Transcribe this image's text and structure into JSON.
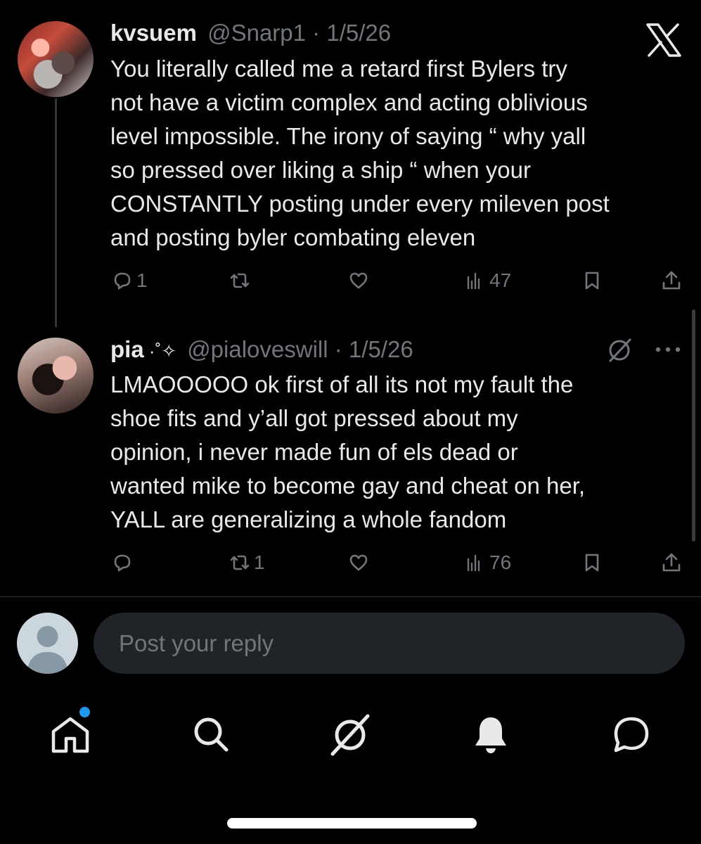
{
  "tweets": [
    {
      "display_name": "kvsuem",
      "handle": "@Snarp1",
      "separator": " · ",
      "date": "1/5/26",
      "lines": [
        "You literally called me a retard first Bylers try",
        "not have a victim complex and acting oblivious",
        "level impossible. The irony of saying “ why yall",
        "so pressed over liking a ship “ when your",
        "CONSTANTLY posting under every mileven post",
        "and posting byler combating eleven"
      ],
      "reply_count": "1",
      "repost_count": "",
      "view_count": "47"
    },
    {
      "display_name": "pia",
      "name_decoration": " ·˚✧",
      "handle": "@pialoveswill",
      "separator": " · ",
      "date": "1/5/26",
      "lines": [
        "LMAOOOOO ok first of all its not my fault the",
        "shoe fits and y’all got pressed about my",
        "opinion, i never made fun of els dead or",
        "wanted mike to become gay and cheat on her,",
        "YALL are generalizing a whole fandom"
      ],
      "reply_count": "",
      "repost_count": "1",
      "view_count": "76"
    }
  ],
  "reply": {
    "placeholder": "Post your reply"
  },
  "brand_logo": "X",
  "colors": {
    "background": "#000000",
    "text": "#e7e9ea",
    "muted": "#71767b",
    "accent": "#1d9bf0"
  },
  "icons": [
    "reply-icon",
    "repost-icon",
    "like-icon",
    "views-icon",
    "bookmark-icon",
    "share-icon",
    "grok-icon",
    "more-icon",
    "home-icon",
    "search-icon",
    "grok-nav-icon",
    "notifications-icon",
    "messages-icon"
  ]
}
